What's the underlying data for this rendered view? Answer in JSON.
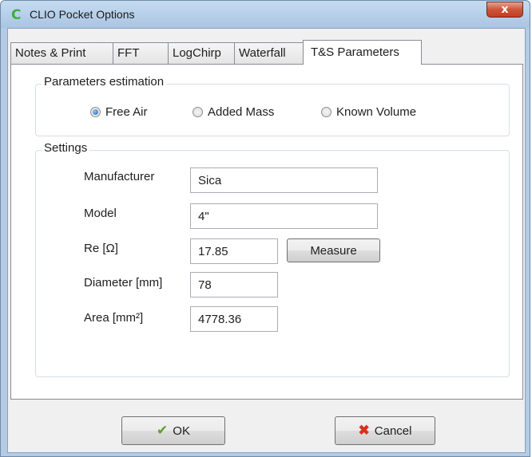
{
  "window": {
    "title": "CLIO Pocket Options",
    "app_icon": "clio-c-icon",
    "close_glyph": "x",
    "accent_close": "#c9563c"
  },
  "tabs": [
    {
      "label": "Notes & Print",
      "active": false
    },
    {
      "label": "FFT",
      "active": false
    },
    {
      "label": "LogChirp",
      "active": false
    },
    {
      "label": "Waterfall",
      "active": false
    },
    {
      "label": "T&S Parameters",
      "active": true
    }
  ],
  "estimation": {
    "group_label": "Parameters estimation",
    "options": [
      {
        "label": "Free Air",
        "checked": true
      },
      {
        "label": "Added Mass",
        "checked": false
      },
      {
        "label": "Known Volume",
        "checked": false
      }
    ]
  },
  "settings": {
    "group_label": "Settings",
    "manufacturer_label": "Manufacturer",
    "manufacturer_value": "Sica",
    "model_label": "Model",
    "model_value": "4\"",
    "re_label": "Re [Ω]",
    "re_value": "17.85",
    "measure_label": "Measure",
    "diameter_label": "Diameter [mm]",
    "diameter_value": "78",
    "area_label": "Area [mm²]",
    "area_value": "4778.36"
  },
  "footer": {
    "ok_label": "OK",
    "ok_icon": "checkmark-icon",
    "cancel_label": "Cancel",
    "cancel_icon": "red-x-icon"
  }
}
